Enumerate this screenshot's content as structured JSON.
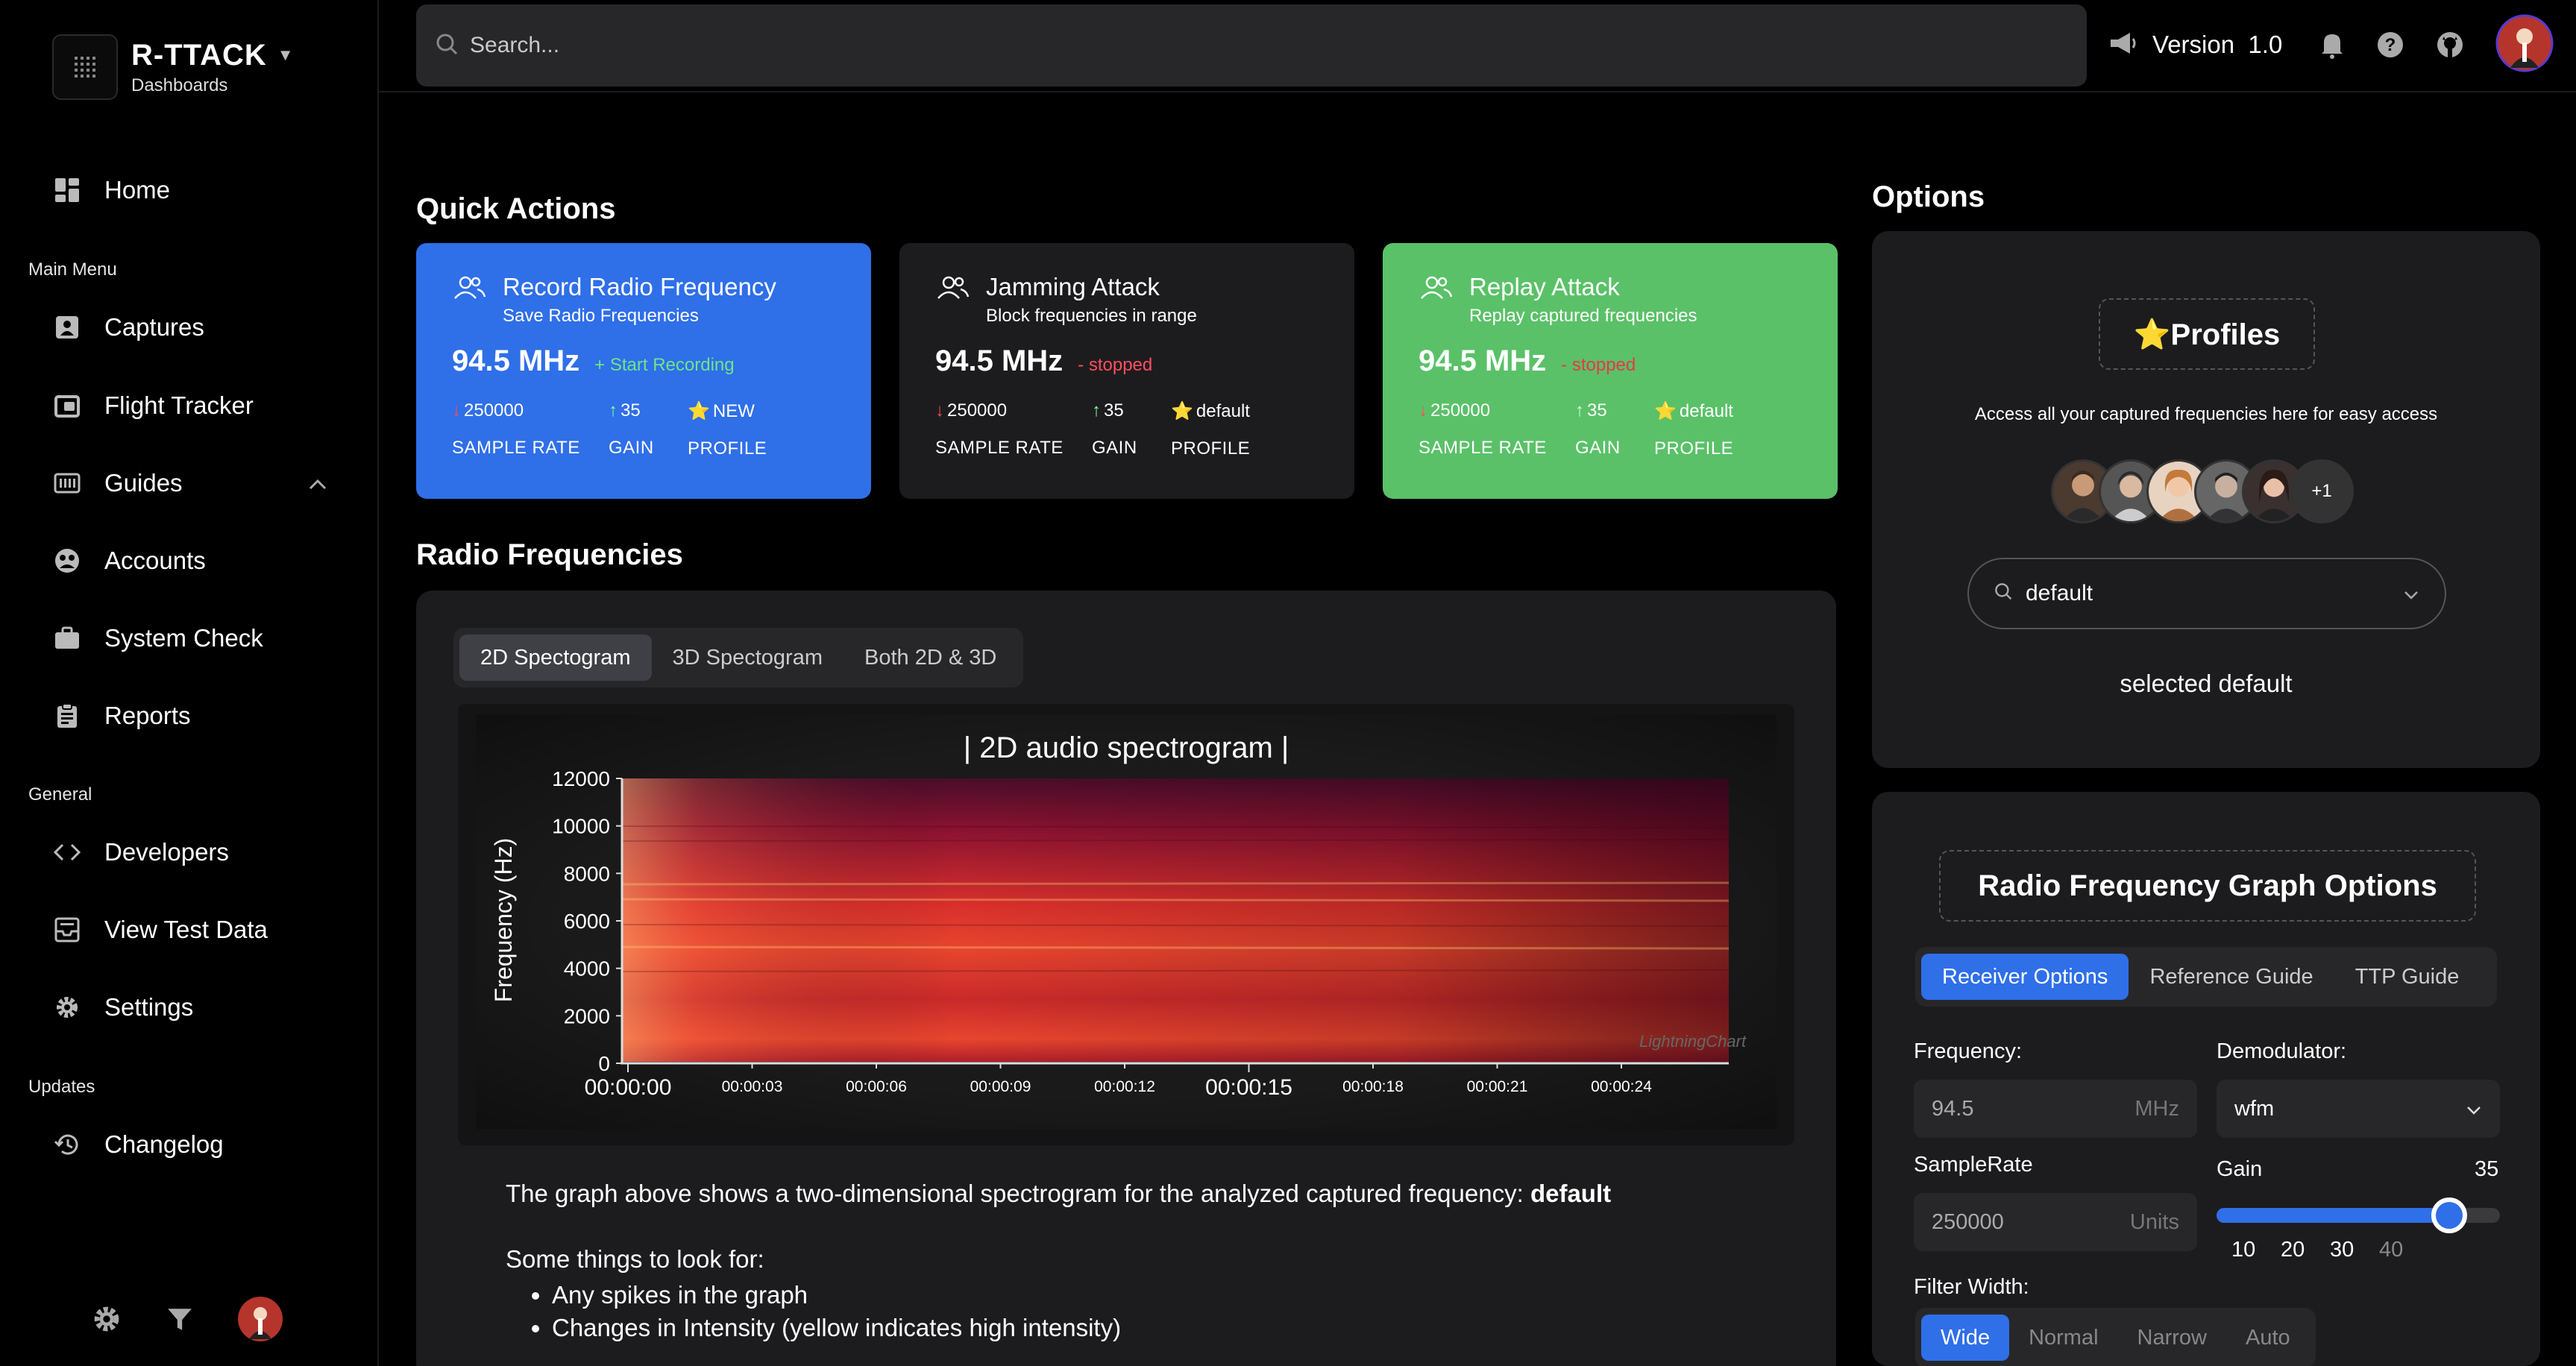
{
  "sidebar": {
    "brand_title": "R-TTACK",
    "brand_sub": "Dashboards",
    "home": "Home",
    "section_main": "Main Menu",
    "main_items": [
      "Captures",
      "Flight Tracker",
      "Guides",
      "Accounts",
      "System Check",
      "Reports"
    ],
    "section_general": "General",
    "general_items": [
      "Developers",
      "View Test Data",
      "Settings"
    ],
    "section_updates": "Updates",
    "updates_items": [
      "Changelog"
    ]
  },
  "topbar": {
    "search_placeholder": "Search...",
    "version_label": "Version",
    "version_number": "1.0"
  },
  "quick_actions": {
    "title": "Quick Actions",
    "cards": [
      {
        "title": "Record Radio Frequency",
        "subtitle": "Save Radio Frequencies",
        "freq": "94.5 MHz",
        "status": "+ Start Recording",
        "sample_rate": "250000",
        "gain": "35",
        "profile": "NEW",
        "sample_rate_label": "SAMPLE RATE",
        "gain_label": "GAIN",
        "profile_label": "PROFILE"
      },
      {
        "title": "Jamming Attack",
        "subtitle": "Block frequencies in range",
        "freq": "94.5 MHz",
        "status": "- stopped",
        "sample_rate": "250000",
        "gain": "35",
        "profile": "default",
        "sample_rate_label": "SAMPLE RATE",
        "gain_label": "GAIN",
        "profile_label": "PROFILE"
      },
      {
        "title": "Replay Attack",
        "subtitle": "Replay captured frequencies",
        "freq": "94.5 MHz",
        "status": "- stopped",
        "sample_rate": "250000",
        "gain": "35",
        "profile": "default",
        "sample_rate_label": "SAMPLE RATE",
        "gain_label": "GAIN",
        "profile_label": "PROFILE"
      }
    ],
    "colors": {
      "blue": "#2f6fe8",
      "dark": "#1c1c1e",
      "green": "#5ac168"
    }
  },
  "radio": {
    "title": "Radio Frequencies",
    "tabs": [
      "2D Spectogram",
      "3D Spectogram",
      "Both 2D & 3D"
    ],
    "spectrogram": {
      "title": "| 2D audio spectrogram |",
      "ylabel": "Frequency (Hz)",
      "y_ticks": [
        "12000",
        "10000",
        "8000",
        "6000",
        "4000",
        "2000",
        "0"
      ],
      "x_major": [
        "00:00:00",
        "00:00:15"
      ],
      "x_minor": [
        "00:00:03",
        "00:00:06",
        "00:00:09",
        "00:00:12",
        "00:00:18",
        "00:00:21",
        "00:00:24"
      ],
      "watermark": "LightningChart"
    },
    "desc_intro": "The graph above shows a two-dimensional spectrogram for the analyzed captured frequency: ",
    "desc_bold": "default",
    "desc_list_intro": "Some things to look for:",
    "desc_items": [
      "Any spikes in the graph",
      "Changes in Intensity (yellow indicates high intensity)"
    ]
  },
  "options": {
    "title": "Options",
    "profiles_label": "⭐Profiles",
    "profiles_desc": "Access all your captured frequencies here for easy access",
    "avatar_more": "+1",
    "selected_profile": "default",
    "selected_text": "selected default",
    "rf_title": "Radio Frequency Graph Options",
    "rf_tabs": [
      "Receiver Options",
      "Reference Guide",
      "TTP Guide"
    ],
    "frequency_label": "Frequency:",
    "frequency_value": "94.5",
    "frequency_unit": "MHz",
    "demod_label": "Demodulator:",
    "demod_value": "wfm",
    "samplerate_label": "SampleRate",
    "samplerate_value": "250000",
    "samplerate_unit": "Units",
    "gain_label": "Gain",
    "gain_value": "35",
    "gain_fraction": 0.82,
    "gain_ticks": [
      "10",
      "20",
      "30",
      "40"
    ],
    "filter_label": "Filter Width:",
    "filter_options": [
      "Wide",
      "Normal",
      "Narrow",
      "Auto"
    ]
  }
}
